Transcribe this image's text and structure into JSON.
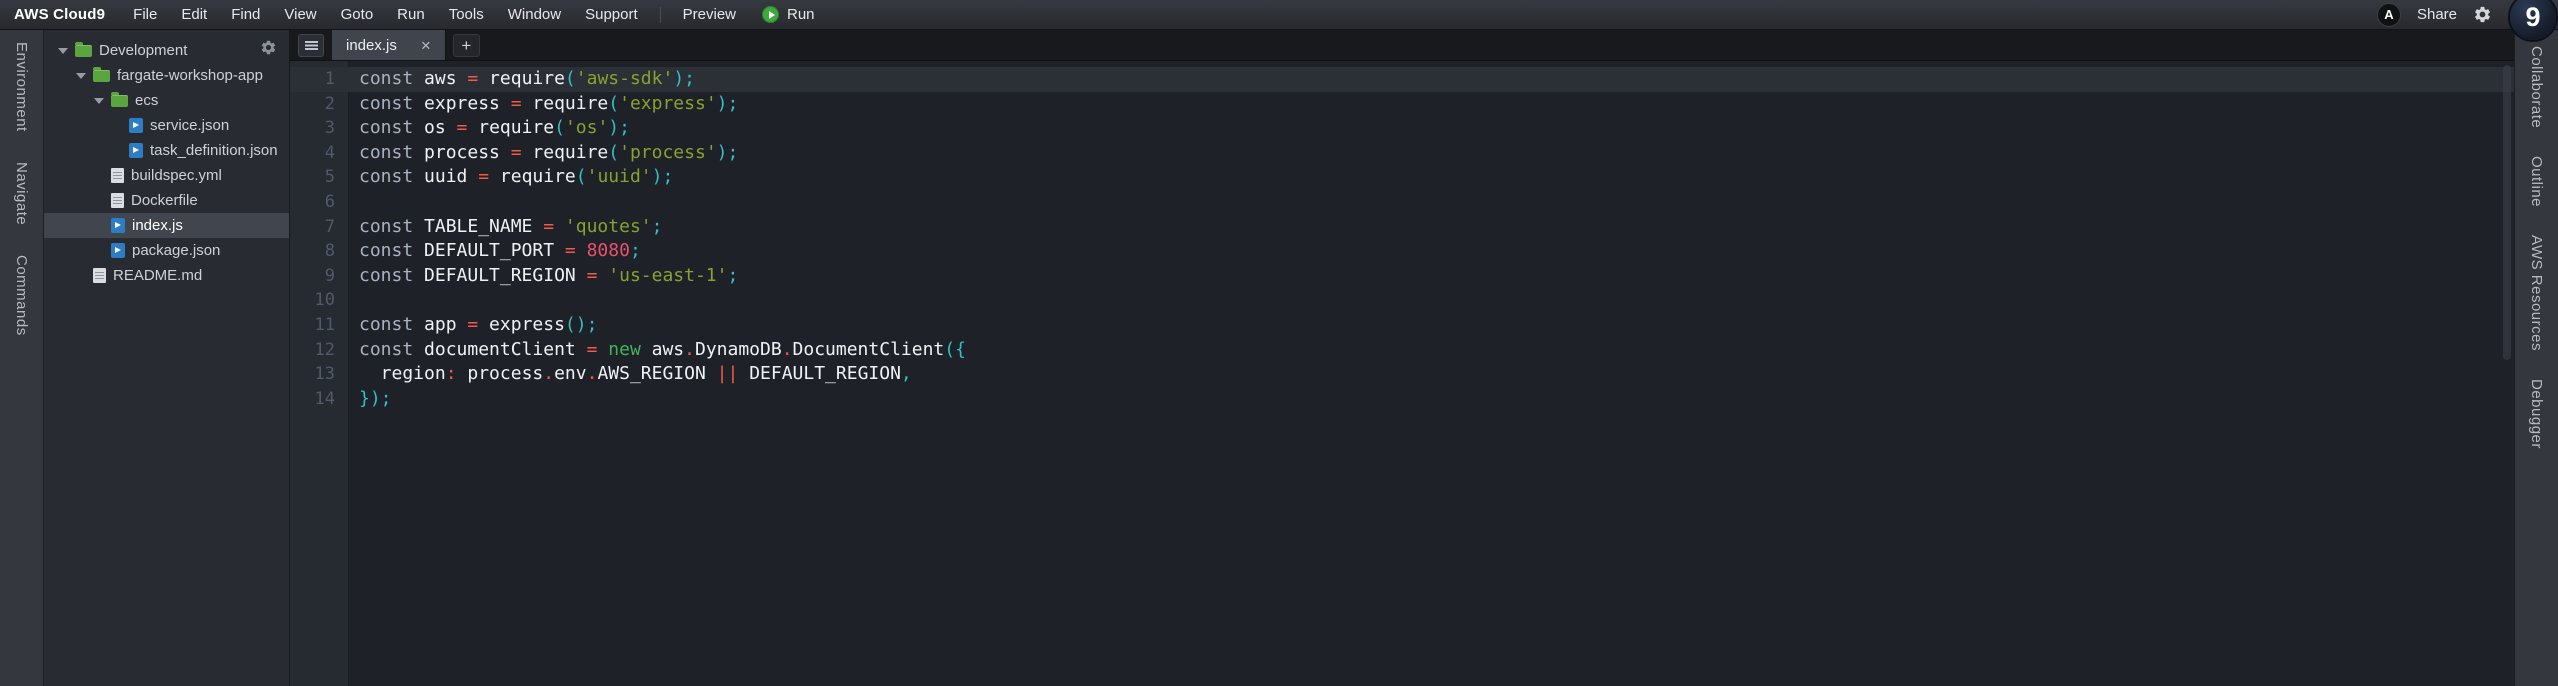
{
  "menubar": {
    "brand": "AWS Cloud9",
    "menus": [
      "File",
      "Edit",
      "Find",
      "View",
      "Goto",
      "Run",
      "Tools",
      "Window",
      "Support"
    ],
    "preview_label": "Preview",
    "run_label": "Run",
    "share_label": "Share",
    "avatar_letter": "A",
    "logo_glyph": "9"
  },
  "left_rail": {
    "tabs": [
      "Environment",
      "Navigate",
      "Commands"
    ]
  },
  "right_rail": {
    "tabs": [
      "Collaborate",
      "Outline",
      "AWS Resources",
      "Debugger"
    ]
  },
  "file_tree": {
    "items": [
      {
        "label": "Development",
        "type": "folder",
        "depth": 0,
        "expanded": true
      },
      {
        "label": "fargate-workshop-app",
        "type": "folder",
        "depth": 1,
        "expanded": true
      },
      {
        "label": "ecs",
        "type": "folder",
        "depth": 2,
        "expanded": true
      },
      {
        "label": "service.json",
        "type": "file-code",
        "depth": 3
      },
      {
        "label": "task_definition.json",
        "type": "file-code",
        "depth": 3
      },
      {
        "label": "buildspec.yml",
        "type": "file",
        "depth": 2
      },
      {
        "label": "Dockerfile",
        "type": "file",
        "depth": 2
      },
      {
        "label": "index.js",
        "type": "file-code",
        "depth": 2,
        "selected": true
      },
      {
        "label": "package.json",
        "type": "file-code",
        "depth": 2
      },
      {
        "label": "README.md",
        "type": "file",
        "depth": 1
      }
    ]
  },
  "editor": {
    "tab": {
      "label": "index.js",
      "close_glyph": "×"
    },
    "new_tab_glyph": "+",
    "active_line": 1,
    "code_lines": [
      {
        "n": 1,
        "t": [
          [
            "kw",
            "const"
          ],
          [
            "id",
            " aws "
          ],
          [
            "op",
            "="
          ],
          [
            "id",
            " require"
          ],
          [
            "pn",
            "("
          ],
          [
            "st",
            "'aws-sdk'"
          ],
          [
            "pn",
            ");"
          ]
        ]
      },
      {
        "n": 2,
        "t": [
          [
            "kw",
            "const"
          ],
          [
            "id",
            " express "
          ],
          [
            "op",
            "="
          ],
          [
            "id",
            " require"
          ],
          [
            "pn",
            "("
          ],
          [
            "st",
            "'express'"
          ],
          [
            "pn",
            ");"
          ]
        ]
      },
      {
        "n": 3,
        "t": [
          [
            "kw",
            "const"
          ],
          [
            "id",
            " os "
          ],
          [
            "op",
            "="
          ],
          [
            "id",
            " require"
          ],
          [
            "pn",
            "("
          ],
          [
            "st",
            "'os'"
          ],
          [
            "pn",
            ");"
          ]
        ]
      },
      {
        "n": 4,
        "t": [
          [
            "kw",
            "const"
          ],
          [
            "id",
            " process "
          ],
          [
            "op",
            "="
          ],
          [
            "id",
            " require"
          ],
          [
            "pn",
            "("
          ],
          [
            "st",
            "'process'"
          ],
          [
            "pn",
            ");"
          ]
        ]
      },
      {
        "n": 5,
        "t": [
          [
            "kw",
            "const"
          ],
          [
            "id",
            " uuid "
          ],
          [
            "op",
            "="
          ],
          [
            "id",
            " require"
          ],
          [
            "pn",
            "("
          ],
          [
            "st",
            "'uuid'"
          ],
          [
            "pn",
            ");"
          ]
        ]
      },
      {
        "n": 6,
        "t": []
      },
      {
        "n": 7,
        "t": [
          [
            "kw",
            "const"
          ],
          [
            "id",
            " TABLE_NAME "
          ],
          [
            "op",
            "="
          ],
          [
            "id",
            " "
          ],
          [
            "st",
            "'quotes'"
          ],
          [
            "pn",
            ";"
          ]
        ]
      },
      {
        "n": 8,
        "t": [
          [
            "kw",
            "const"
          ],
          [
            "id",
            " DEFAULT_PORT "
          ],
          [
            "op",
            "="
          ],
          [
            "id",
            " "
          ],
          [
            "nu",
            "8080"
          ],
          [
            "pn",
            ";"
          ]
        ]
      },
      {
        "n": 9,
        "t": [
          [
            "kw",
            "const"
          ],
          [
            "id",
            " DEFAULT_REGION "
          ],
          [
            "op",
            "="
          ],
          [
            "id",
            " "
          ],
          [
            "st",
            "'us-east-1'"
          ],
          [
            "pn",
            ";"
          ]
        ]
      },
      {
        "n": 10,
        "t": []
      },
      {
        "n": 11,
        "t": [
          [
            "kw",
            "const"
          ],
          [
            "id",
            " app "
          ],
          [
            "op",
            "="
          ],
          [
            "id",
            " express"
          ],
          [
            "pn",
            "();"
          ]
        ]
      },
      {
        "n": 12,
        "t": [
          [
            "kw",
            "const"
          ],
          [
            "id",
            " documentClient "
          ],
          [
            "op",
            "="
          ],
          [
            "id",
            " "
          ],
          [
            "kw2",
            "new"
          ],
          [
            "id",
            " aws"
          ],
          [
            "op",
            "."
          ],
          [
            "id",
            "DynamoDB"
          ],
          [
            "op",
            "."
          ],
          [
            "id",
            "DocumentClient"
          ],
          [
            "pn",
            "({"
          ]
        ]
      },
      {
        "n": 13,
        "t": [
          [
            "id",
            "  region"
          ],
          [
            "op",
            ":"
          ],
          [
            "id",
            " process"
          ],
          [
            "op",
            "."
          ],
          [
            "id",
            "env"
          ],
          [
            "op",
            "."
          ],
          [
            "id",
            "AWS_REGION "
          ],
          [
            "op",
            "||"
          ],
          [
            "id",
            " DEFAULT_REGION"
          ],
          [
            "pn",
            ","
          ]
        ]
      },
      {
        "n": 14,
        "t": [
          [
            "pn",
            "});"
          ]
        ]
      }
    ]
  }
}
